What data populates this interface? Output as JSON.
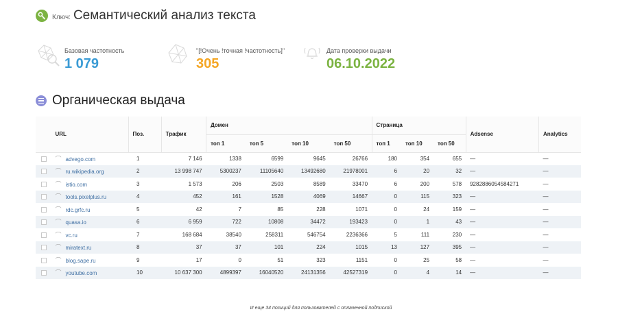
{
  "header": {
    "key_prefix": "Ключ:",
    "title": "Семантический анализ текста"
  },
  "stats": [
    {
      "label": "Базовая частотность",
      "value": "1 079",
      "color": "#3a9bd5",
      "icon": "search-network-icon"
    },
    {
      "label": "\"[!Очень !точная !частотность]\"",
      "value": "305",
      "color": "#f5a623",
      "icon": "network-icon"
    },
    {
      "label": "Дата проверки выдачи",
      "value": "06.10.2022",
      "color": "#7cb342",
      "icon": "bell-icon"
    }
  ],
  "section": {
    "title": "Органическая выдача"
  },
  "table": {
    "headers": {
      "url": "URL",
      "pos": "Поз.",
      "traffic": "Трафик",
      "domain": "Домен",
      "page": "Страница",
      "adsense": "Adsense",
      "analytics": "Analytics"
    },
    "sub_headers": {
      "domain": [
        "топ 1",
        "топ 5",
        "топ 10",
        "топ 50"
      ],
      "page": [
        "топ 1",
        "топ 10",
        "топ 50"
      ]
    },
    "rows": [
      {
        "url": "advego.com",
        "pos": "1",
        "traffic": "7 146",
        "d1": "1338",
        "d5": "6599",
        "d10": "9645",
        "d50": "26766",
        "p1": "180",
        "p10": "354",
        "p50": "655",
        "adsense": "—",
        "analytics": "—"
      },
      {
        "url": "ru.wikipedia.org",
        "pos": "2",
        "traffic": "13 998 747",
        "d1": "5300237",
        "d5": "11105640",
        "d10": "13492680",
        "d50": "21978001",
        "p1": "6",
        "p10": "20",
        "p50": "32",
        "adsense": "—",
        "analytics": "—"
      },
      {
        "url": "istio.com",
        "pos": "3",
        "traffic": "1 573",
        "d1": "206",
        "d5": "2503",
        "d10": "8589",
        "d50": "33470",
        "p1": "6",
        "p10": "200",
        "p50": "578",
        "adsense": "9282886054584271",
        "analytics": "—"
      },
      {
        "url": "tools.pixelplus.ru",
        "pos": "4",
        "traffic": "452",
        "d1": "161",
        "d5": "1528",
        "d10": "4069",
        "d50": "14667",
        "p1": "0",
        "p10": "115",
        "p50": "323",
        "adsense": "—",
        "analytics": "—"
      },
      {
        "url": "rdc.grfc.ru",
        "pos": "5",
        "traffic": "42",
        "d1": "7",
        "d5": "85",
        "d10": "228",
        "d50": "1071",
        "p1": "0",
        "p10": "24",
        "p50": "159",
        "adsense": "—",
        "analytics": "—"
      },
      {
        "url": "quasa.io",
        "pos": "6",
        "traffic": "6 959",
        "d1": "722",
        "d5": "10808",
        "d10": "34472",
        "d50": "193423",
        "p1": "0",
        "p10": "1",
        "p50": "43",
        "adsense": "—",
        "analytics": "—"
      },
      {
        "url": "vc.ru",
        "pos": "7",
        "traffic": "168 684",
        "d1": "38540",
        "d5": "258311",
        "d10": "546754",
        "d50": "2236366",
        "p1": "5",
        "p10": "111",
        "p50": "230",
        "adsense": "—",
        "analytics": "—"
      },
      {
        "url": "miratext.ru",
        "pos": "8",
        "traffic": "37",
        "d1": "37",
        "d5": "101",
        "d10": "224",
        "d50": "1015",
        "p1": "13",
        "p10": "127",
        "p50": "395",
        "adsense": "—",
        "analytics": "—"
      },
      {
        "url": "blog.sape.ru",
        "pos": "9",
        "traffic": "17",
        "d1": "0",
        "d5": "51",
        "d10": "323",
        "d50": "1151",
        "p1": "0",
        "p10": "25",
        "p50": "58",
        "adsense": "—",
        "analytics": "—"
      },
      {
        "url": "youtube.com",
        "pos": "10",
        "traffic": "10 637 300",
        "d1": "4899397",
        "d5": "16040520",
        "d10": "24131356",
        "d50": "42527319",
        "p1": "0",
        "p10": "4",
        "p50": "14",
        "adsense": "—",
        "analytics": "—"
      }
    ]
  },
  "footer_note": "И еще 34 позиций для пользователей с оплаченной подпиской"
}
